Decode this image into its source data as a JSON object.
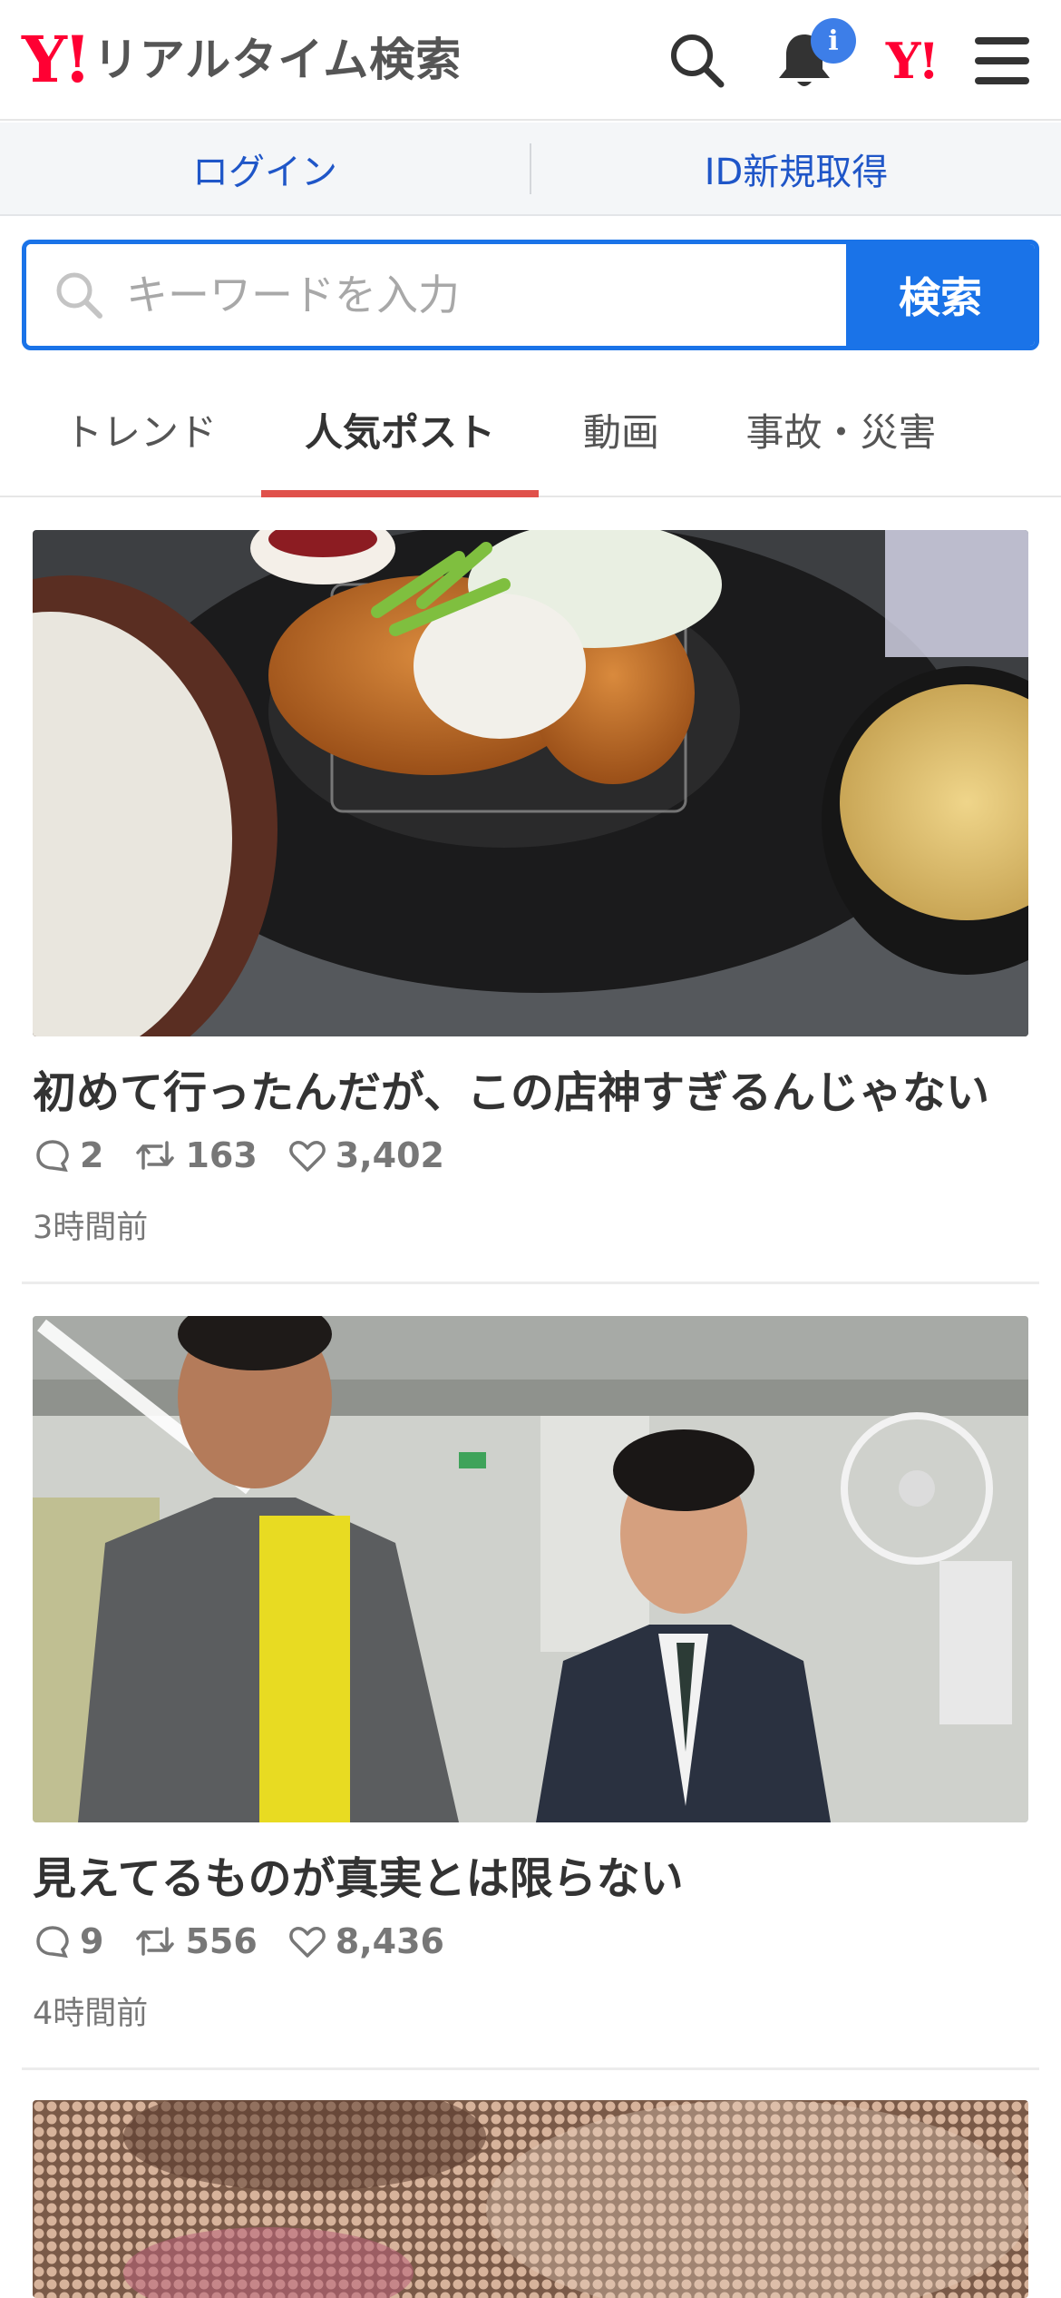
{
  "header": {
    "logo_mark": "Y!",
    "logo_text": "リアルタイム検索",
    "notification_badge": "i",
    "yj_mark": "Y!"
  },
  "login_bar": {
    "login": "ログイン",
    "signup": "ID新規取得"
  },
  "search": {
    "placeholder": "キーワードを入力",
    "button": "検索"
  },
  "tabs": [
    {
      "label": "トレンド",
      "active": false
    },
    {
      "label": "人気ポスト",
      "active": true
    },
    {
      "label": "動画",
      "active": false
    },
    {
      "label": "事故・災害",
      "active": false
    }
  ],
  "posts": [
    {
      "title": "初めて行ったんだが、この店神すぎるんじゃない",
      "replies": "2",
      "reposts": "163",
      "likes": "3,402",
      "time": "3時間前"
    },
    {
      "title": "見えてるものが真実とは限らない",
      "replies": "9",
      "reposts": "556",
      "likes": "8,436",
      "time": "4時間前"
    }
  ],
  "colors": {
    "brand_red": "#ff0033",
    "accent_blue": "#1a73e8",
    "link_blue": "#1f56c8",
    "tab_underline": "#e0514b",
    "badge_blue": "#3d7ee8"
  }
}
